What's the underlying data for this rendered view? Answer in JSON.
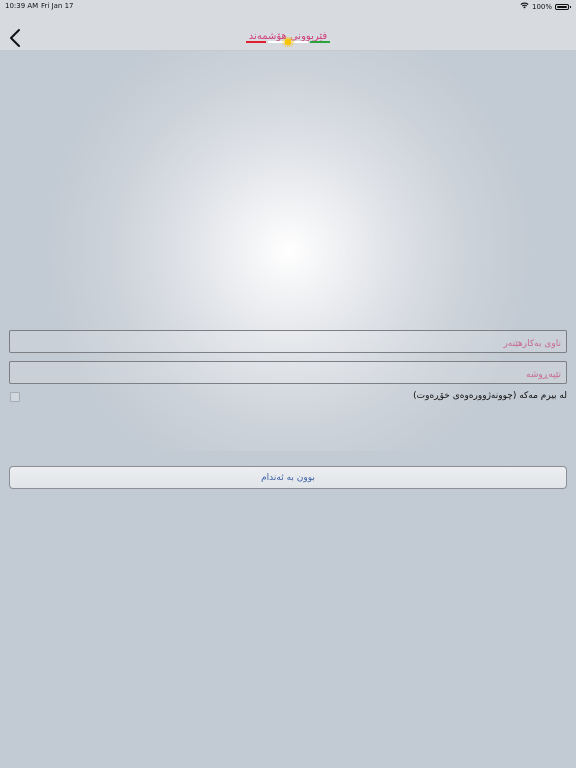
{
  "status_bar": {
    "time": "10:39 AM",
    "date": "Fri Jan 17",
    "battery_text": "100%",
    "wifi_icon": "wifi-icon",
    "battery_icon": "battery-icon"
  },
  "nav": {
    "back_icon": "chevron-left-icon",
    "title": "فێربوونی هۆشمەند",
    "flag_colors": [
      "#e2202b",
      "#ffffff",
      "#f7c400",
      "#2aa53d"
    ]
  },
  "form": {
    "username_placeholder": "ناوی بەکارهێنەر",
    "password_placeholder": "تێپەڕوشە",
    "remember_label": "لە بیرم مەکە (چوونەژوورەوەی خۆڕەوت)",
    "remember_checked": false,
    "signup_label": "بوون بە ئەندام"
  },
  "colors": {
    "accent": "#d0407a",
    "button_text": "#3d62a8",
    "background": "#c2cad3"
  }
}
